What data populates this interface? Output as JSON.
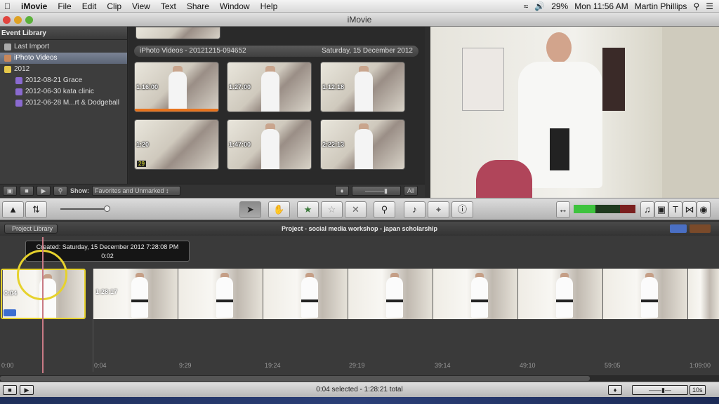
{
  "menubar": {
    "app": "iMovie",
    "items": [
      "File",
      "Edit",
      "Clip",
      "View",
      "Text",
      "Share",
      "Window",
      "Help"
    ],
    "battery": "29%",
    "clock": "Mon 11:56 AM",
    "user": "Martin Phillips"
  },
  "window": {
    "title": "iMovie"
  },
  "sidebar": {
    "title": "Event Library",
    "items": [
      {
        "label": "Last Import",
        "icon": "import-icon",
        "indent": 0
      },
      {
        "label": "iPhoto Videos",
        "icon": "iphoto-icon",
        "indent": 0,
        "selected": true
      },
      {
        "label": "2012",
        "icon": "folder-icon",
        "indent": 0
      },
      {
        "label": "2012-08-21 Grace",
        "icon": "event-star-icon",
        "indent": 1
      },
      {
        "label": "2012-06-30 kata clinic",
        "icon": "event-star-icon",
        "indent": 1
      },
      {
        "label": "2012-06-28 M...rt & Dodgeball",
        "icon": "event-star-icon",
        "indent": 1
      }
    ]
  },
  "browser": {
    "event_title": "iPhoto Videos - 20121215-094652",
    "event_date": "Saturday, 15 December 2012",
    "thumbs": [
      {
        "duration": "1:16:00"
      },
      {
        "duration": "1:27:00"
      },
      {
        "duration": "1:12:18"
      },
      {
        "duration": "1:20",
        "badge": "29"
      },
      {
        "duration": "1:47:00"
      },
      {
        "duration": "2:22:13"
      }
    ]
  },
  "event_toolbar": {
    "show_label": "Show:",
    "filter": "Favorites and Unmarked",
    "all_label": "All"
  },
  "toolbar": {
    "buttons": [
      "pointer",
      "hand",
      "favorite-star",
      "unfavorite-star",
      "reject",
      "keyword",
      "voiceover",
      "crop",
      "info"
    ]
  },
  "project": {
    "library_button": "Project Library",
    "title": "Project - social media workshop - japan scholarship",
    "tooltip_line1": "Created: Saturday, 15 December 2012 7:28:08 PM",
    "tooltip_line2": "0:02",
    "clip_labels": [
      "0:04",
      "1:28:17"
    ],
    "ruler": [
      "0:00",
      "0:04",
      "9:29",
      "19:24",
      "29:19",
      "39:14",
      "49:10",
      "59:05",
      "1:09:00"
    ]
  },
  "status": {
    "text": "0:04 selected - 1:28:21 total",
    "zoom": "10s"
  },
  "colors": {
    "selection": "#e6d22d",
    "playhead": "#c97a85",
    "accent_bar": "#e8741e"
  }
}
